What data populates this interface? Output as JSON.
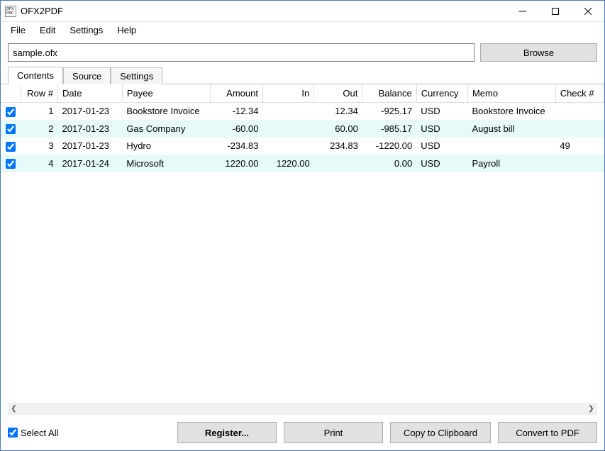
{
  "window": {
    "title": "OFX2PDF",
    "icon_text": "OFX\nPDF"
  },
  "menubar": {
    "items": [
      "File",
      "Edit",
      "Settings",
      "Help"
    ]
  },
  "filebar": {
    "filename": "sample.ofx",
    "browse_label": "Browse"
  },
  "tabs": {
    "items": [
      "Contents",
      "Source",
      "Settings"
    ],
    "active_index": 0
  },
  "table": {
    "headers": {
      "rownum": "Row #",
      "date": "Date",
      "payee": "Payee",
      "amount": "Amount",
      "in": "In",
      "out": "Out",
      "balance": "Balance",
      "currency": "Currency",
      "memo": "Memo",
      "check": "Check #"
    },
    "rows": [
      {
        "checked": true,
        "rownum": "1",
        "date": "2017-01-23",
        "payee": "Bookstore Invoice",
        "amount": "-12.34",
        "in": "",
        "out": "12.34",
        "balance": "-925.17",
        "currency": "USD",
        "memo": "Bookstore Invoice",
        "check": ""
      },
      {
        "checked": true,
        "rownum": "2",
        "date": "2017-01-23",
        "payee": "Gas Company",
        "amount": "-60.00",
        "in": "",
        "out": "60.00",
        "balance": "-985.17",
        "currency": "USD",
        "memo": "August bill",
        "check": ""
      },
      {
        "checked": true,
        "rownum": "3",
        "date": "2017-01-23",
        "payee": "Hydro",
        "amount": "-234.83",
        "in": "",
        "out": "234.83",
        "balance": "-1220.00",
        "currency": "USD",
        "memo": "",
        "check": "49"
      },
      {
        "checked": true,
        "rownum": "4",
        "date": "2017-01-24",
        "payee": "Microsoft",
        "amount": "1220.00",
        "in": "1220.00",
        "out": "",
        "balance": "0.00",
        "currency": "USD",
        "memo": "Payroll",
        "check": ""
      }
    ]
  },
  "bottombar": {
    "selectall_label": "Select All",
    "selectall_checked": true,
    "register_label": "Register...",
    "print_label": "Print",
    "copy_label": "Copy to Clipboard",
    "convert_label": "Convert to PDF"
  }
}
